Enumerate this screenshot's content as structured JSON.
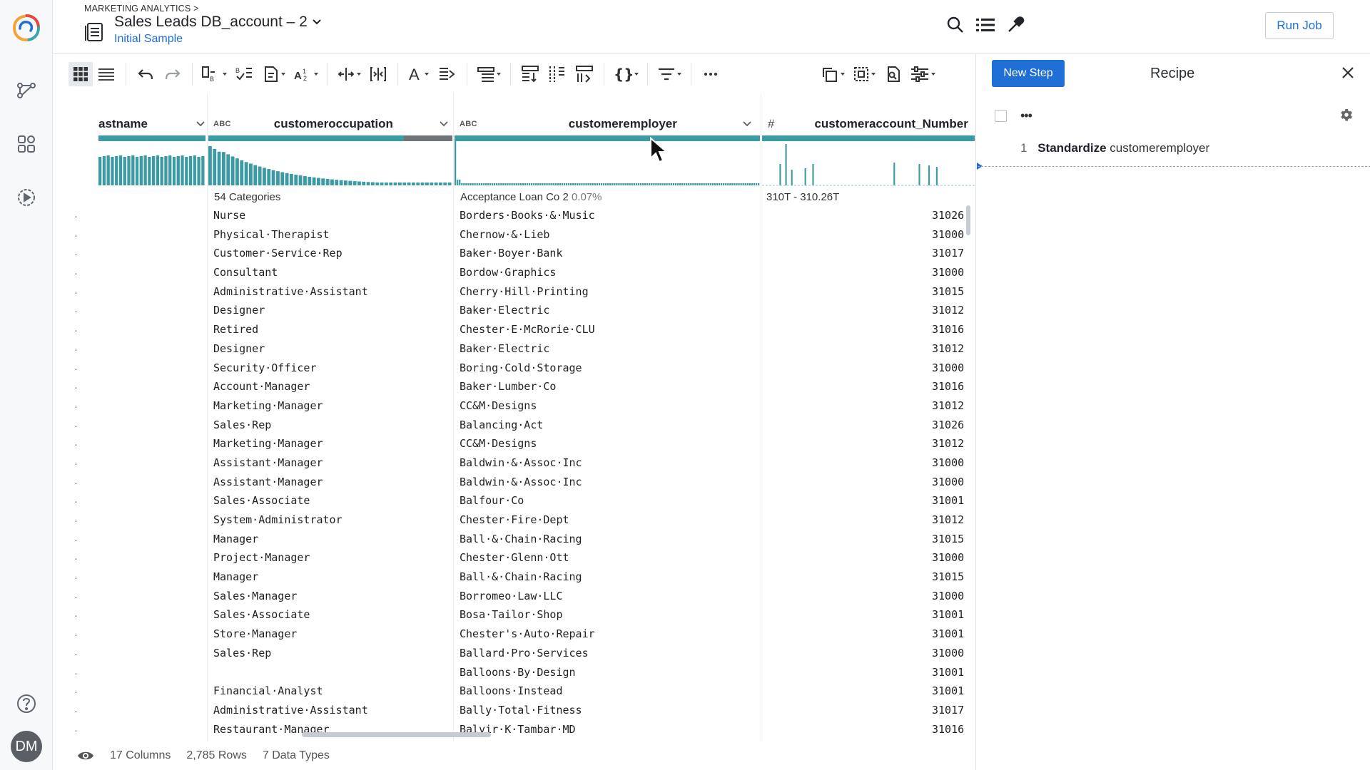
{
  "header": {
    "breadcrumb": "MARKETING ANALYTICS >",
    "title": "Sales Leads DB_account – 2",
    "subtitle": "Initial Sample",
    "run_job_label": "Run Job"
  },
  "toolbar": {
    "items": [
      "grid-view",
      "list-view",
      "undo",
      "redo",
      "merge-columns",
      "data-quality",
      "format-column",
      "number-sort",
      "move-column",
      "split-column",
      "text-format",
      "text-align",
      "group-by",
      "pivot",
      "unpivot",
      "transpose",
      "nest",
      "filter",
      "more",
      "copy",
      "select-region",
      "find",
      "settings-sliders"
    ]
  },
  "columns": [
    {
      "name": "astname",
      "type": ""
    },
    {
      "name": "customeroccupation",
      "type": "ABC",
      "summary": "54 Categories"
    },
    {
      "name": "customeremployer",
      "type": "ABC",
      "summary": "Acceptance Loan Co",
      "summary_count": "2",
      "summary_pct": "0.07%"
    },
    {
      "name": "customeraccount_Number",
      "type": "#",
      "summary": "310T - 310.26T"
    }
  ],
  "rows": [
    {
      "occupation": "Nurse",
      "employer": "Borders·Books·&·Music",
      "account": "31026"
    },
    {
      "occupation": "Physical·Therapist",
      "employer": "Chernow·&·Lieb",
      "account": "31000"
    },
    {
      "occupation": "Customer·Service·Rep",
      "employer": "Baker·Boyer·Bank",
      "account": "31017"
    },
    {
      "occupation": "Consultant",
      "employer": "Bordow·Graphics",
      "account": "31000"
    },
    {
      "occupation": "Administrative·Assistant",
      "employer": "Cherry·Hill·Printing",
      "account": "31015"
    },
    {
      "occupation": "Designer",
      "employer": "Baker·Electric",
      "account": "31012"
    },
    {
      "occupation": "Retired",
      "employer": "Chester·E·McRorie·CLU",
      "account": "31016"
    },
    {
      "occupation": "Designer",
      "employer": "Baker·Electric",
      "account": "31012"
    },
    {
      "occupation": "Security·Officer",
      "employer": "Boring·Cold·Storage",
      "account": "31000"
    },
    {
      "occupation": "Account·Manager",
      "employer": "Baker·Lumber·Co",
      "account": "31016"
    },
    {
      "occupation": "Marketing·Manager",
      "employer": "CC&M·Designs",
      "account": "31012"
    },
    {
      "occupation": "Sales·Rep",
      "employer": "Balancing·Act",
      "account": "31026"
    },
    {
      "occupation": "Marketing·Manager",
      "employer": "CC&M·Designs",
      "account": "31012"
    },
    {
      "occupation": "Assistant·Manager",
      "employer": "Baldwin·&·Assoc·Inc",
      "account": "31000"
    },
    {
      "occupation": "Assistant·Manager",
      "employer": "Baldwin·&·Assoc·Inc",
      "account": "31000"
    },
    {
      "occupation": "Sales·Associate",
      "employer": "Balfour·Co",
      "account": "31001"
    },
    {
      "occupation": "System·Administrator",
      "employer": "Chester·Fire·Dept",
      "account": "31012"
    },
    {
      "occupation": "Manager",
      "employer": "Ball·&·Chain·Racing",
      "account": "31015"
    },
    {
      "occupation": "Project·Manager",
      "employer": "Chester·Glenn·Ott",
      "account": "31000"
    },
    {
      "occupation": "Manager",
      "employer": "Ball·&·Chain·Racing",
      "account": "31015"
    },
    {
      "occupation": "Sales·Manager",
      "employer": "Borromeo·Law·LLC",
      "account": "31000"
    },
    {
      "occupation": "Sales·Associate",
      "employer": "Bosa·Tailor·Shop",
      "account": "31001"
    },
    {
      "occupation": "Store·Manager",
      "employer": "Chester's·Auto·Repair",
      "account": "31001"
    },
    {
      "occupation": "Sales·Rep",
      "employer": "Ballard·Pro·Services",
      "account": "31000"
    },
    {
      "occupation": "",
      "employer": "Balloons·By·Design",
      "account": "31001"
    },
    {
      "occupation": "Financial·Analyst",
      "employer": "Balloons·Instead",
      "account": "31001"
    },
    {
      "occupation": "Administrative·Assistant",
      "employer": "Bally·Total·Fitness",
      "account": "31017"
    },
    {
      "occupation": "Restaurant·Manager",
      "employer": "Balvir·K·Tambar·MD",
      "account": "31016"
    }
  ],
  "footer": {
    "columns": "17 Columns",
    "rows": "2,785 Rows",
    "types": "7 Data Types"
  },
  "recipe": {
    "new_step_label": "New Step",
    "title": "Recipe",
    "step_number": "1",
    "step_action": "Standardize",
    "step_target": "customeremployer"
  },
  "user": {
    "initials": "DM"
  },
  "colors": {
    "accent": "#1f6fd6",
    "bar": "#3b9aa3",
    "mismatch": "#6f747a"
  }
}
